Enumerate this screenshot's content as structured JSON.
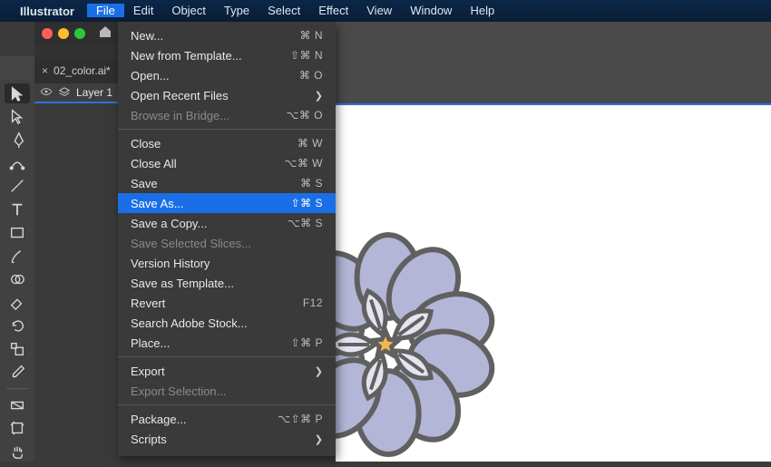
{
  "menubar": {
    "app_name": "Illustrator",
    "items": [
      "File",
      "Edit",
      "Object",
      "Type",
      "Select",
      "Effect",
      "View",
      "Window",
      "Help"
    ],
    "selected_index": 0
  },
  "tab": {
    "label": "02_color.ai*",
    "close_glyph": "×"
  },
  "layers": {
    "label": "Layer 1"
  },
  "tools": [
    {
      "name": "selection-tool",
      "selected": true
    },
    {
      "name": "direct-selection-tool"
    },
    {
      "name": "pen-tool"
    },
    {
      "name": "curvature-tool"
    },
    {
      "name": "line-tool"
    },
    {
      "name": "text-tool"
    },
    {
      "name": "rectangle-tool"
    },
    {
      "name": "brush-tool"
    },
    {
      "name": "shape-builder-tool"
    },
    {
      "name": "eraser-tool"
    },
    {
      "name": "rotate-tool"
    },
    {
      "name": "scale-tool"
    },
    {
      "name": "eyedropper-tool"
    },
    {
      "name": "gradient-tool"
    },
    {
      "name": "artboard-tool"
    },
    {
      "name": "hand-tool"
    }
  ],
  "file_menu": [
    {
      "label": "New...",
      "shortcut": "⌘ N"
    },
    {
      "label": "New from Template...",
      "shortcut": "⇧⌘ N"
    },
    {
      "label": "Open...",
      "shortcut": "⌘ O"
    },
    {
      "label": "Open Recent Files",
      "submenu": true
    },
    {
      "label": "Browse in Bridge...",
      "shortcut": "⌥⌘ O",
      "disabled": true
    },
    {
      "sep": true
    },
    {
      "label": "Close",
      "shortcut": "⌘ W"
    },
    {
      "label": "Close All",
      "shortcut": "⌥⌘ W"
    },
    {
      "label": "Save",
      "shortcut": "⌘ S"
    },
    {
      "label": "Save As...",
      "shortcut": "⇧⌘ S",
      "highlight": true
    },
    {
      "label": "Save a Copy...",
      "shortcut": "⌥⌘ S"
    },
    {
      "label": "Save Selected Slices...",
      "disabled": true
    },
    {
      "label": "Version History"
    },
    {
      "label": "Save as Template..."
    },
    {
      "label": "Revert",
      "shortcut": "F12"
    },
    {
      "label": "Search Adobe Stock..."
    },
    {
      "label": "Place...",
      "shortcut": "⇧⌘ P"
    },
    {
      "sep": true
    },
    {
      "label": "Export",
      "submenu": true
    },
    {
      "label": "Export Selection...",
      "disabled": true
    },
    {
      "sep": true
    },
    {
      "label": "Package...",
      "shortcut": "⌥⇧⌘ P"
    },
    {
      "label": "Scripts",
      "submenu": true
    }
  ],
  "artwork": {
    "stroke": "#606060",
    "petal_outer": "#b3b6d6",
    "petal_inner": "#e4e3f0",
    "center": "#f1b94d"
  }
}
